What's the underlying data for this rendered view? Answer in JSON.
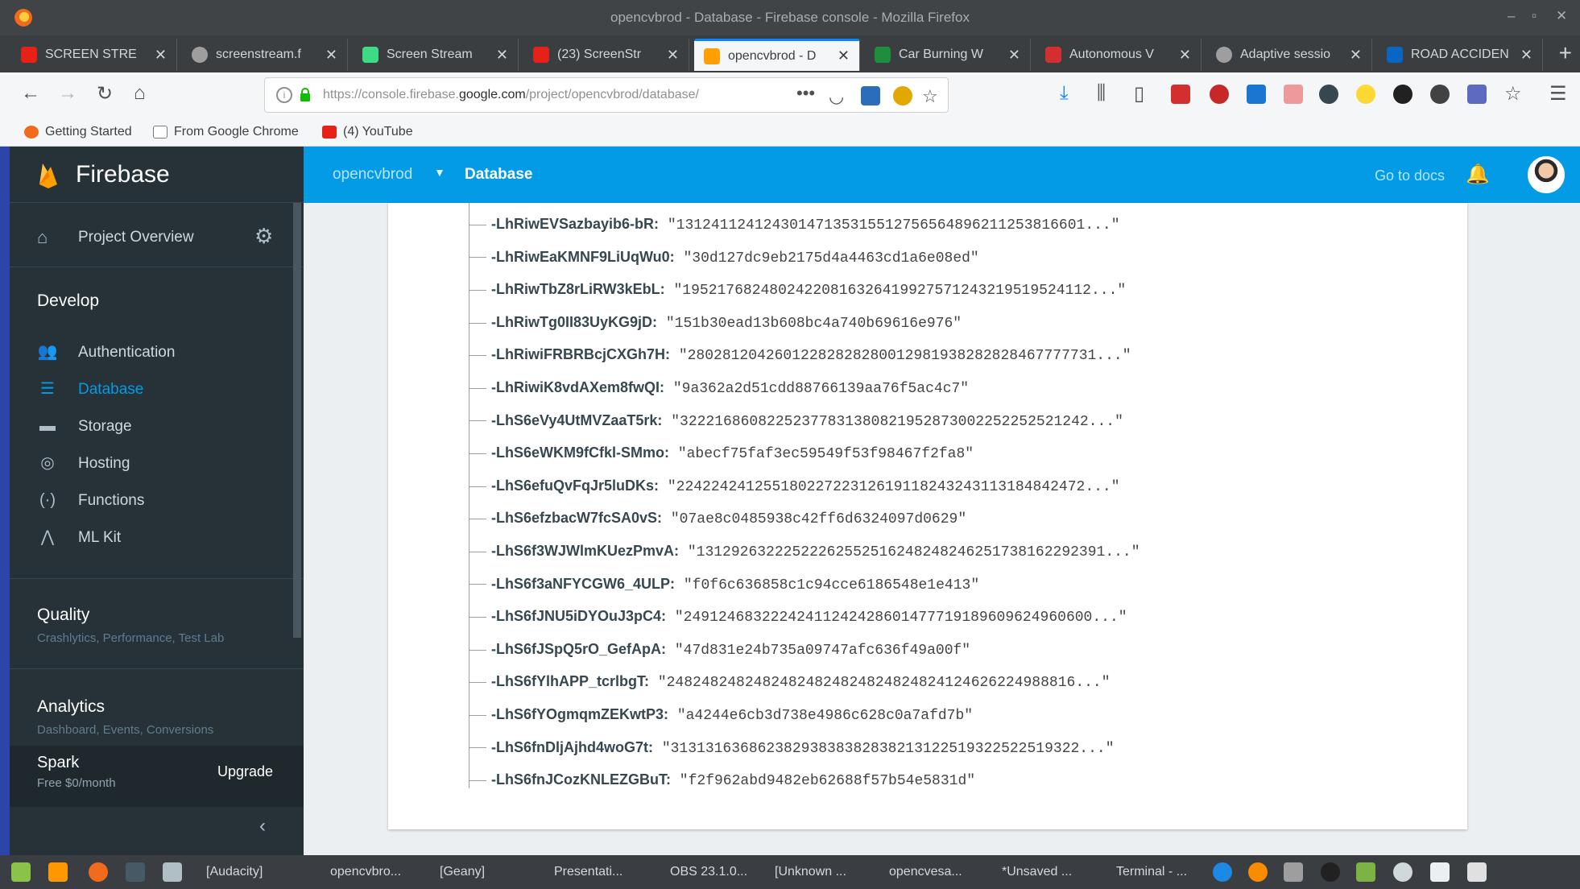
{
  "window": {
    "title": "opencvbrod - Database - Firebase console - Mozilla Firefox"
  },
  "tabs": [
    {
      "label": "SCREEN STRE",
      "color": "#e62117"
    },
    {
      "label": "screenstream.f",
      "color": "#9e9e9e"
    },
    {
      "label": "Screen Stream",
      "color": "#3ddc84"
    },
    {
      "label": "(23) ScreenStr",
      "color": "#e62117"
    },
    {
      "label": "opencvbrod - D",
      "color": "#ffa000",
      "active": true
    },
    {
      "label": "Car Burning W",
      "color": "#1e8e3e"
    },
    {
      "label": "Autonomous V",
      "color": "#d32f2f"
    },
    {
      "label": "Adaptive sessio",
      "color": "#9e9e9e"
    },
    {
      "label": "ROAD ACCIDEN",
      "color": "#0a66c2"
    }
  ],
  "navbar": {
    "url_prefix": "https://console.firebase.",
    "url_domain": "google.com",
    "url_suffix": "/project/opencvbrod/database/"
  },
  "bookmarks": [
    {
      "label": "Getting Started",
      "color": "#f26a1b"
    },
    {
      "label": "From Google Chrome",
      "color": "#9e9e9e"
    },
    {
      "label": "(4) YouTube",
      "color": "#e62117"
    }
  ],
  "firebase": {
    "brand": "Firebase",
    "project_overview": "Project Overview",
    "develop_title": "Develop",
    "develop_items": [
      {
        "label": "Authentication",
        "icon": "people-icon"
      },
      {
        "label": "Database",
        "icon": "database-icon",
        "active": true
      },
      {
        "label": "Storage",
        "icon": "folder-icon"
      },
      {
        "label": "Hosting",
        "icon": "globe-icon"
      },
      {
        "label": "Functions",
        "icon": "functions-icon"
      },
      {
        "label": "ML Kit",
        "icon": "ml-kit-icon"
      }
    ],
    "quality_title": "Quality",
    "quality_sub": "Crashlytics, Performance, Test Lab",
    "analytics_title": "Analytics",
    "analytics_sub": "Dashboard, Events, Conversions",
    "plan_name": "Spark",
    "plan_price": "Free $0/month",
    "upgrade_label": "Upgrade",
    "collapse_glyph": "‹",
    "project_name": "opencvbrod",
    "section_name": "Database",
    "go_to_docs": "Go to docs"
  },
  "database_rows": [
    {
      "key": "-LhRiwEVSazbayib6-bR:",
      "value": "\"13124112412430147135315512756564896211253816601...\""
    },
    {
      "key": "-LhRiwEaKMNF9LiUqWu0:",
      "value": "\"30d127dc9eb2175d4a4463cd1a6e08ed\""
    },
    {
      "key": "-LhRiwTbZ8rLiRW3kEbL:",
      "value": "\"19521768248024220816326419927571243219519524112...\""
    },
    {
      "key": "-LhRiwTg0II83UyKG9jD:",
      "value": "\"151b30ead13b608bc4a740b69616e976\""
    },
    {
      "key": "-LhRiwiFRBRBcjCXGh7H:",
      "value": "\"28028120426012282828280012981938282828467777731...\""
    },
    {
      "key": "-LhRiwiK8vdAXem8fwQI:",
      "value": "\"9a362a2d51cdd88766139aa76f5ac4c7\""
    },
    {
      "key": "-LhS6eVy4UtMVZaaT5rk:",
      "value": "\"32221686082252377831380821952873002252252521242...\""
    },
    {
      "key": "-LhS6eWKM9fCfkl-SMmo:",
      "value": "\"abecf75faf3ec59549f53f98467f2fa8\""
    },
    {
      "key": "-LhS6efuQvFqJr5luDKs:",
      "value": "\"22422424125518022722312619118243243113184842472...\""
    },
    {
      "key": "-LhS6efzbacW7fcSA0vS:",
      "value": "\"07ae8c0485938c42ff6d6324097d0629\""
    },
    {
      "key": "-LhS6f3WJWlmKUezPmvA:",
      "value": "\"13129263222522262552516248248246251738162292391...\""
    },
    {
      "key": "-LhS6f3aNFYCGW6_4ULP:",
      "value": "\"f0f6c636858c1c94cce6186548e1e413\""
    },
    {
      "key": "-LhS6fJNU5iDYOuJ3pC4:",
      "value": "\"24912468322242411242428601477719189609624960600...\""
    },
    {
      "key": "-LhS6fJSpQ5rO_GefApA:",
      "value": "\"47d831e24b735a09747afc636f49a00f\""
    },
    {
      "key": "-LhS6fYlhAPP_tcrlbgT:",
      "value": "\"24824824824824824824824824824824124626224988816...\""
    },
    {
      "key": "-LhS6fYOgmqmZEKwtP3:",
      "value": "\"a4244e6cb3d738e4986c628c0a7afd7b\""
    },
    {
      "key": "-LhS6fnDljAjhd4woG7t:",
      "value": "\"31313163686238293838382838213122519322522519322...\""
    },
    {
      "key": "-LhS6fnJCozKNLEZGBuT:",
      "value": "\"f2f962abd9482eb62688f57b54e5831d\""
    }
  ],
  "taskbar": {
    "items": [
      {
        "label": "[Audacity]"
      },
      {
        "label": "opencvbro..."
      },
      {
        "label": "[Geany]"
      },
      {
        "label": "Presentati..."
      },
      {
        "label": "OBS 23.1.0..."
      },
      {
        "label": "[Unknown ..."
      },
      {
        "label": "opencvesa..."
      },
      {
        "label": "*Unsaved ..."
      },
      {
        "label": "Terminal - ..."
      }
    ]
  },
  "colors": {
    "firebase_blue": "#039be5",
    "sidebar_bg": "#263238",
    "firebase_flame": "#ffa000"
  }
}
